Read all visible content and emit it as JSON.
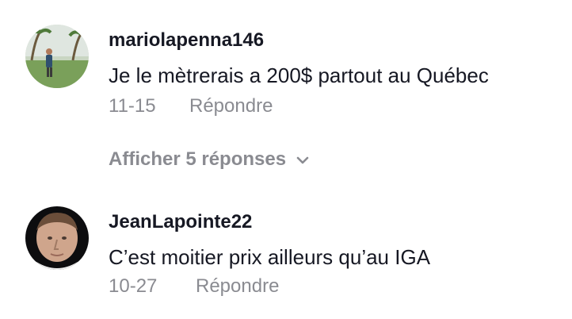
{
  "comments": [
    {
      "username": "mariolapenna146",
      "text": "Je le mètrerais a 200$ partout au Québec",
      "date": "11-15",
      "reply_label": "Répondre",
      "show_replies_label": "Afficher 5 réponses"
    },
    {
      "username": "JeanLapointe22",
      "text": "C’est moitier prix ailleurs qu’au IGA",
      "date": "10-27",
      "reply_label": "Répondre"
    }
  ],
  "colors": {
    "primary_text": "#161823",
    "secondary_text": "#8a8b91",
    "background": "#ffffff"
  },
  "icons": {
    "expand": "chevron-down-icon"
  }
}
